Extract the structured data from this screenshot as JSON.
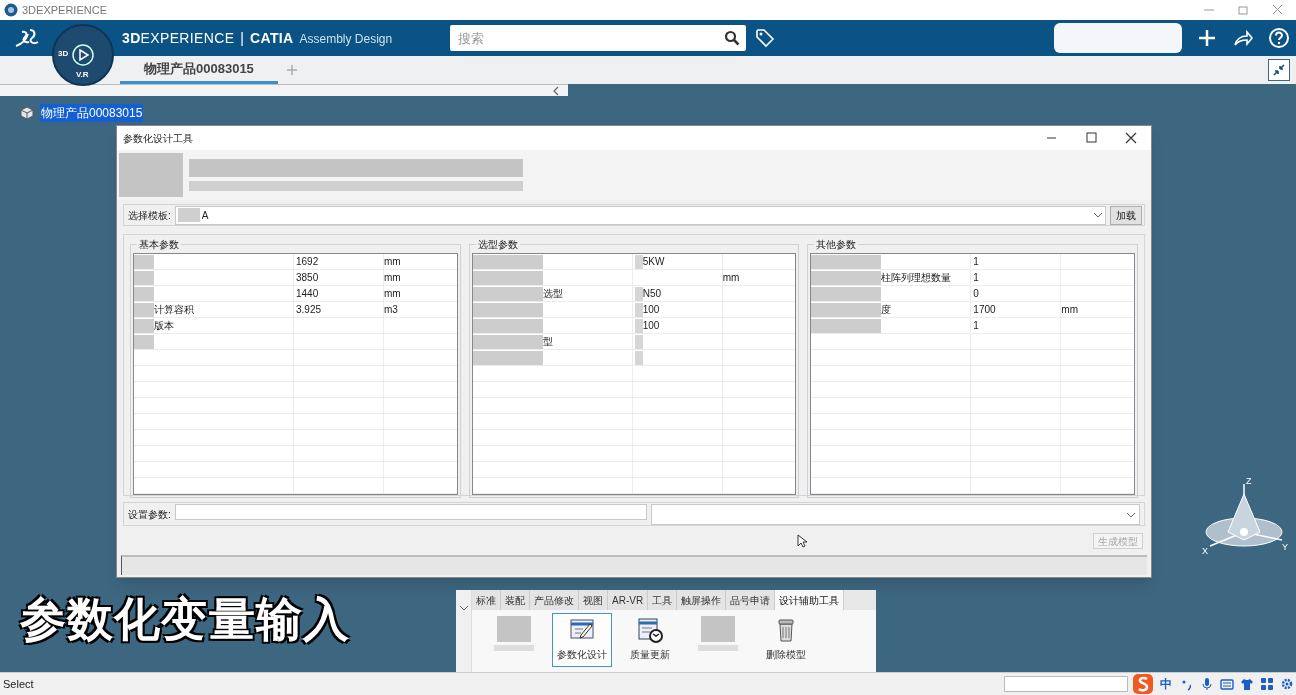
{
  "window": {
    "title": "3DEXPERIENCE"
  },
  "app_bar": {
    "brand_bold": "3D",
    "brand": "EXPERIENCE",
    "separator": "|",
    "app": "CATIA",
    "module": "Assembly Design",
    "compass_labels": [
      "3D",
      "V.R"
    ],
    "search": {
      "placeholder": "搜索"
    }
  },
  "tabs": [
    {
      "label": "物理产品00083015",
      "selected": true
    }
  ],
  "tree": [
    {
      "label": "物理产品00083015",
      "selected": true
    }
  ],
  "dialog": {
    "title": "参数化设计工具",
    "template": {
      "label": "选择模板:",
      "value": "A"
    },
    "load_button": "加载",
    "groups": [
      {
        "title": "基本参数",
        "rows": [
          {
            "name_obscured": true,
            "value": "1692",
            "unit": "mm"
          },
          {
            "name_obscured": true,
            "value": "3850",
            "unit": "mm"
          },
          {
            "name_obscured": true,
            "value": "1440",
            "unit": "mm"
          },
          {
            "name": "计算容积",
            "name_obscured": true,
            "value": "3.925",
            "unit": "m3"
          },
          {
            "name": "版本",
            "name_obscured": true
          },
          {
            "name_obscured": true
          }
        ]
      },
      {
        "title": "选型参数",
        "rows": [
          {
            "name_obscured": true,
            "value": "5KW",
            "value_obscured": true
          },
          {
            "name_obscured": true,
            "unit": "mm"
          },
          {
            "name": "选型",
            "name_obscured": true,
            "value": "N50",
            "value_obscured": true
          },
          {
            "name_obscured": true,
            "value": "100",
            "value_obscured": true
          },
          {
            "name_obscured": true,
            "value": "100",
            "value_obscured": true
          },
          {
            "name": "型",
            "name_obscured": true,
            "value_obscured": true
          },
          {
            "name_obscured": true,
            "value_obscured": true
          }
        ]
      },
      {
        "title": "其他参数",
        "rows": [
          {
            "name_obscured": true,
            "value": "1"
          },
          {
            "name": "柱阵列理想数量",
            "name_obscured": true,
            "value": "1"
          },
          {
            "name_obscured": true,
            "value": "0"
          },
          {
            "name": "度",
            "name_obscured": true,
            "value": "1700",
            "unit": "mm"
          },
          {
            "name_obscured": true,
            "value": "1"
          }
        ]
      }
    ],
    "set_params": {
      "label": "设置参数:"
    },
    "generate_button": {
      "label": "生成模型",
      "disabled": true
    }
  },
  "toolbar": {
    "tabs": [
      {
        "label": "标准",
        "selected": false
      },
      {
        "label": "装配",
        "selected": false
      },
      {
        "label": "产品修改",
        "selected": false
      },
      {
        "label": "视图",
        "selected": false
      },
      {
        "label": "AR-VR",
        "selected": false
      },
      {
        "label": "工具",
        "selected": false
      },
      {
        "label": "触屏操作",
        "selected": false
      },
      {
        "label": "品号申请",
        "selected": false
      },
      {
        "label": "设计辅助工具",
        "selected": true
      }
    ],
    "tools": [
      {
        "kind": "obscured",
        "selected": false
      },
      {
        "kind": "design",
        "label": "参数化设计",
        "selected": true
      },
      {
        "kind": "update",
        "label": "质量更新",
        "selected": false
      },
      {
        "kind": "obscured",
        "selected": false
      },
      {
        "kind": "delete",
        "label": "删除模型",
        "selected": false
      }
    ]
  },
  "caption": "参数化变量输入",
  "compass_axes": [
    "Z",
    "X",
    "Y"
  ],
  "status_bar": {
    "text": "Select",
    "ime_mode": "中"
  }
}
